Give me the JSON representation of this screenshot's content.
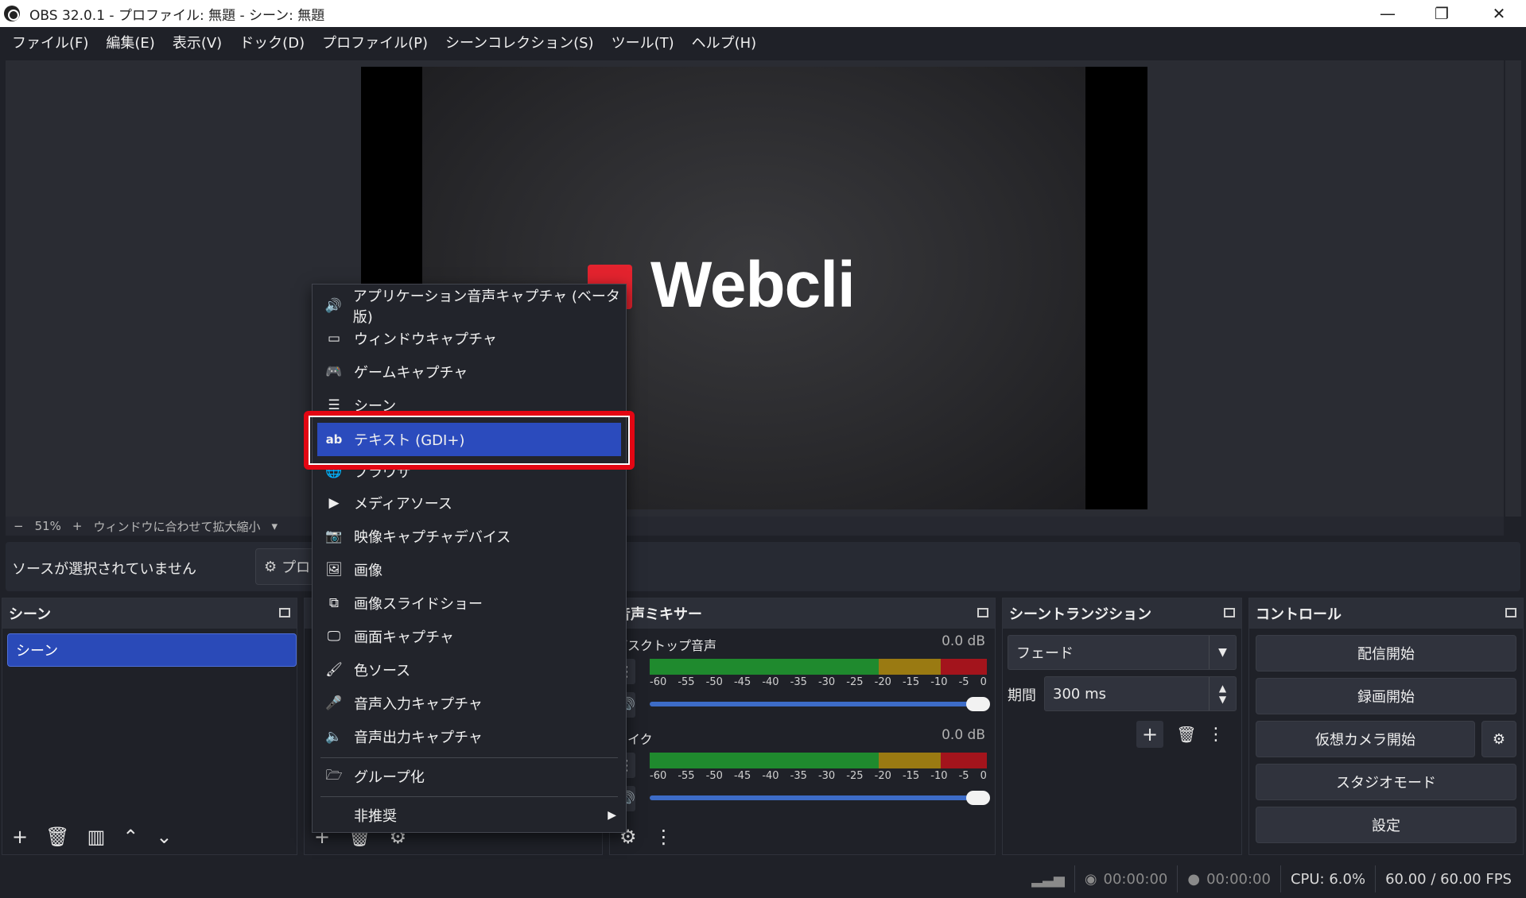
{
  "window": {
    "title": "OBS 32.0.1 - プロファイル: 無題 - シーン: 無題",
    "minimize_glyph": "—",
    "restore_glyph": "❐",
    "close_glyph": "✕"
  },
  "menubar": [
    "ファイル(F)",
    "編集(E)",
    "表示(V)",
    "ドック(D)",
    "プロファイル(P)",
    "シーンコレクション(S)",
    "ツール(T)",
    "ヘルプ(H)"
  ],
  "preview": {
    "logo_text": "Webcli",
    "zoom_minus": "−",
    "zoom_value": "51%",
    "zoom_plus": "+",
    "zoom_mode": "ウィンドウに合わせて拡大縮小"
  },
  "source_bar": {
    "no_source": "ソースが選択されていません",
    "properties_label": "プロ"
  },
  "docks": {
    "scenes": {
      "title": "シーン",
      "items": [
        "シーン"
      ]
    },
    "mixer": {
      "title": "音声ミキサー",
      "tracks": [
        {
          "name": "デスクトップ音声",
          "db": "0.0 dB"
        },
        {
          "name": "マイク",
          "db": "0.0 dB"
        }
      ],
      "scale": [
        "-60",
        "-55",
        "-50",
        "-45",
        "-40",
        "-35",
        "-30",
        "-25",
        "-20",
        "-15",
        "-10",
        "-5",
        "0"
      ]
    },
    "transitions": {
      "title": "シーントランジション",
      "selected": "フェード",
      "duration_label": "期間",
      "duration_value": "300 ms"
    },
    "controls": {
      "title": "コントロール",
      "buttons": [
        "配信開始",
        "録画開始",
        "仮想カメラ開始",
        "スタジオモード",
        "設定"
      ]
    }
  },
  "context_menu": {
    "items": [
      {
        "label": "アプリケーション音声キャプチャ (ベータ版)",
        "icon": "app-audio-icon"
      },
      {
        "label": "ウィンドウキャプチャ",
        "icon": "window-icon"
      },
      {
        "label": "ゲームキャプチャ",
        "icon": "gamepad-icon"
      },
      {
        "label": "シーン",
        "icon": "list-icon"
      },
      {
        "label": "テキスト (GDI+)",
        "icon": "text-icon"
      },
      {
        "label": "ブラウザ",
        "icon": "globe-icon"
      },
      {
        "label": "メディアソース",
        "icon": "play-icon"
      },
      {
        "label": "映像キャプチャデバイス",
        "icon": "camera-icon"
      },
      {
        "label": "画像",
        "icon": "image-icon"
      },
      {
        "label": "画像スライドショー",
        "icon": "slideshow-icon"
      },
      {
        "label": "画面キャプチャ",
        "icon": "monitor-icon"
      },
      {
        "label": "色ソース",
        "icon": "brush-icon"
      },
      {
        "label": "音声入力キャプチャ",
        "icon": "microphone-icon"
      },
      {
        "label": "音声出力キャプチャ",
        "icon": "speaker-icon"
      },
      {
        "label": "グループ化",
        "icon": "folder-icon"
      },
      {
        "label": "非推奨",
        "icon": ""
      }
    ]
  },
  "statusbar": {
    "stream_time": "00:00:00",
    "record_time": "00:00:00",
    "cpu": "CPU: 6.0%",
    "fps": "60.00 / 60.00 FPS"
  },
  "colors": {
    "highlight": "#2b4bbd",
    "annotation_red": "#e30613",
    "meter_green": "#1f8a2e",
    "meter_yellow": "#9a7a12",
    "meter_red": "#a3141c",
    "fader_blue": "#3d6cc7"
  }
}
